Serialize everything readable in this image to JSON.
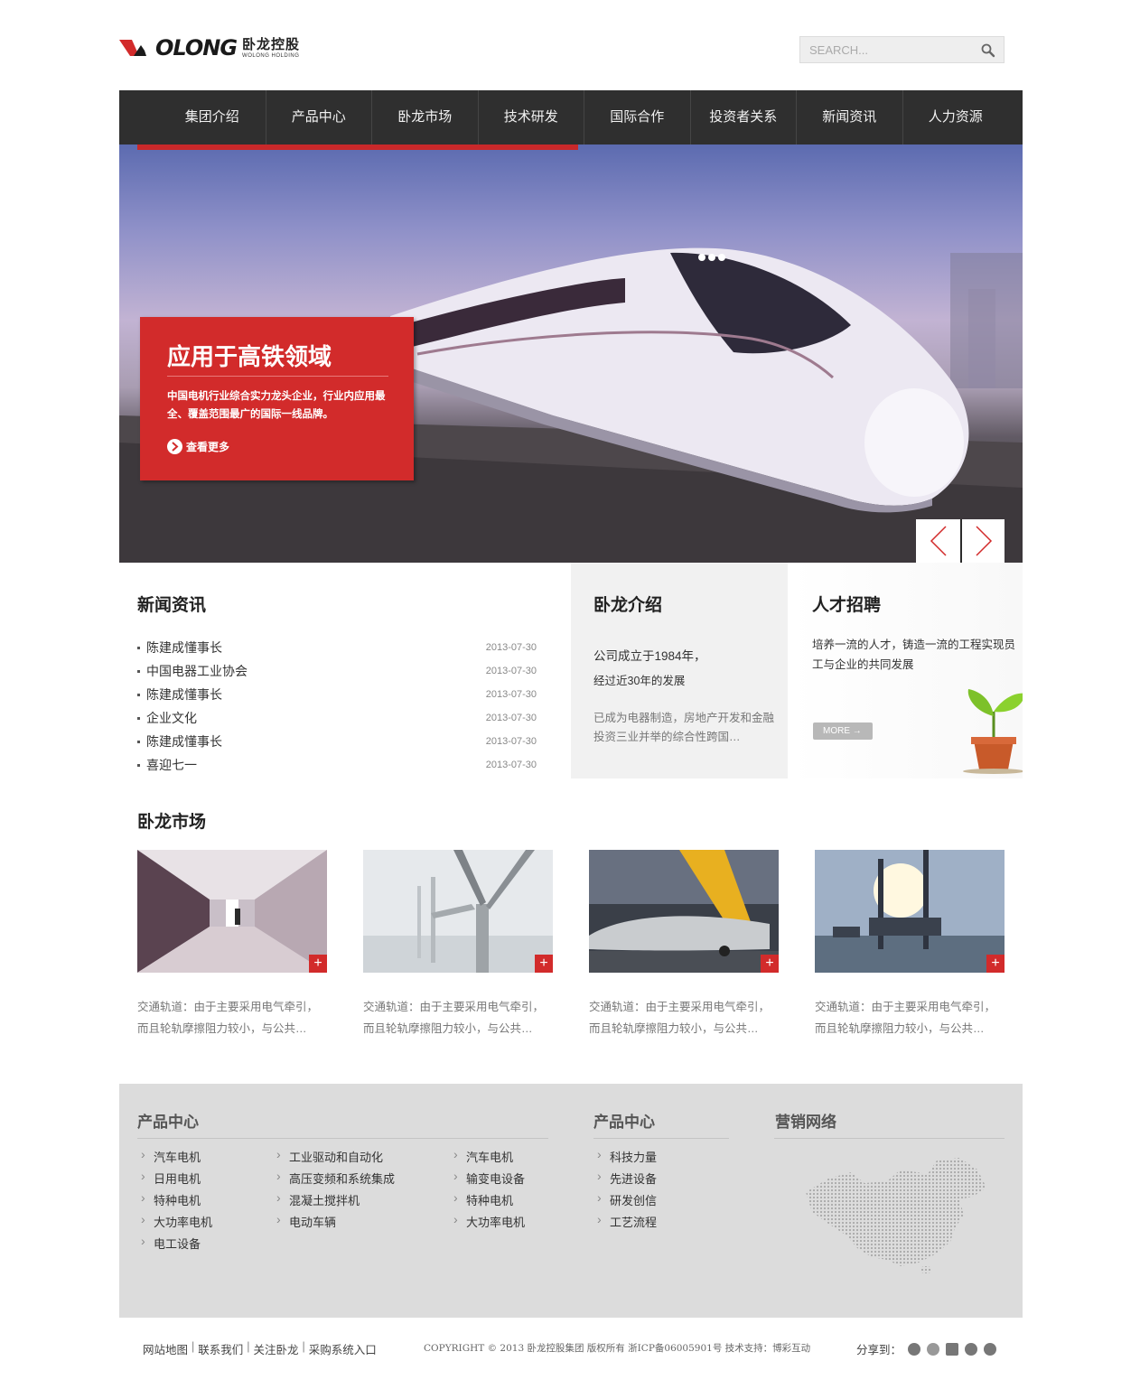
{
  "header": {
    "logo_word": "OLONG",
    "logo_cn": "卧龙控股",
    "logo_sub": "WOLONG HOLDING",
    "search_placeholder": "SEARCH..."
  },
  "nav": [
    "集团介绍",
    "产品中心",
    "卧龙市场",
    "技术研发",
    "国际合作",
    "投资者关系",
    "新闻资讯",
    "人力资源"
  ],
  "banner": {
    "title": "应用于高铁领域",
    "desc": "中国电机行业综合实力龙头企业，行业内应用最全、覆盖范围最广的国际一线品牌。",
    "more": "查看更多"
  },
  "news": {
    "title": "新闻资讯",
    "items": [
      {
        "title": "陈建成懂事长",
        "date": "2013-07-30"
      },
      {
        "title": "中国电器工业协会",
        "date": "2013-07-30"
      },
      {
        "title": "陈建成懂事长",
        "date": "2013-07-30"
      },
      {
        "title": "企业文化",
        "date": "2013-07-30"
      },
      {
        "title": "陈建成懂事长",
        "date": "2013-07-30"
      },
      {
        "title": "喜迎七一",
        "date": "2013-07-30"
      }
    ]
  },
  "about": {
    "title": "卧龙介绍",
    "line1": "公司成立于1984年，",
    "line2": "经过近30年的发展",
    "line3": "已成为电器制造，房地产开发和金融投资三业并举的综合性跨国…"
  },
  "recruit": {
    "title": "人才招聘",
    "desc": "培养一流的人才，铸造一流的工程实现员工与企业的共同发展",
    "more": "MORE →"
  },
  "market": {
    "title": "卧龙市场",
    "plus": "+",
    "cards": [
      {
        "text": "交通轨道：由于主要采用电气牵引，而且轮轨摩擦阻力较小，与公共…"
      },
      {
        "text": "交通轨道：由于主要采用电气牵引，而且轮轨摩擦阻力较小，与公共…"
      },
      {
        "text": "交通轨道：由于主要采用电气牵引，而且轮轨摩擦阻力较小，与公共…"
      },
      {
        "text": "交通轨道：由于主要采用电气牵引，而且轮轨摩擦阻力较小，与公共…"
      }
    ]
  },
  "footer": {
    "col1_title": "产品中心",
    "col1_a": [
      "汽车电机",
      "日用电机",
      "特种电机",
      "大功率电机",
      "电工设备"
    ],
    "col1_b": [
      "工业驱动和自动化",
      "高压变频和系统集成",
      "混凝土搅拌机",
      "电动车辆"
    ],
    "col1_c": [
      "汽车电机",
      "输变电设备",
      "特种电机",
      "大功率电机"
    ],
    "col2_title": "产品中心",
    "col2": [
      "科技力量",
      "先进设备",
      "研发创信",
      "工艺流程"
    ],
    "col3_title": "营销网络"
  },
  "bottom": {
    "links": [
      "网站地图",
      "联系我们",
      "关注卧龙",
      "采购系统入口"
    ],
    "separator": "|",
    "copyright": "COPYRIGHT © 2013 卧龙控股集团 版权所有 浙ICP备06005901号 技术支持：博彩互动",
    "share_label": "分享到："
  },
  "colors": {
    "brand_red": "#d22b2b",
    "nav_bg": "#2f2f2f",
    "footer_bg": "#dcdcdc"
  }
}
